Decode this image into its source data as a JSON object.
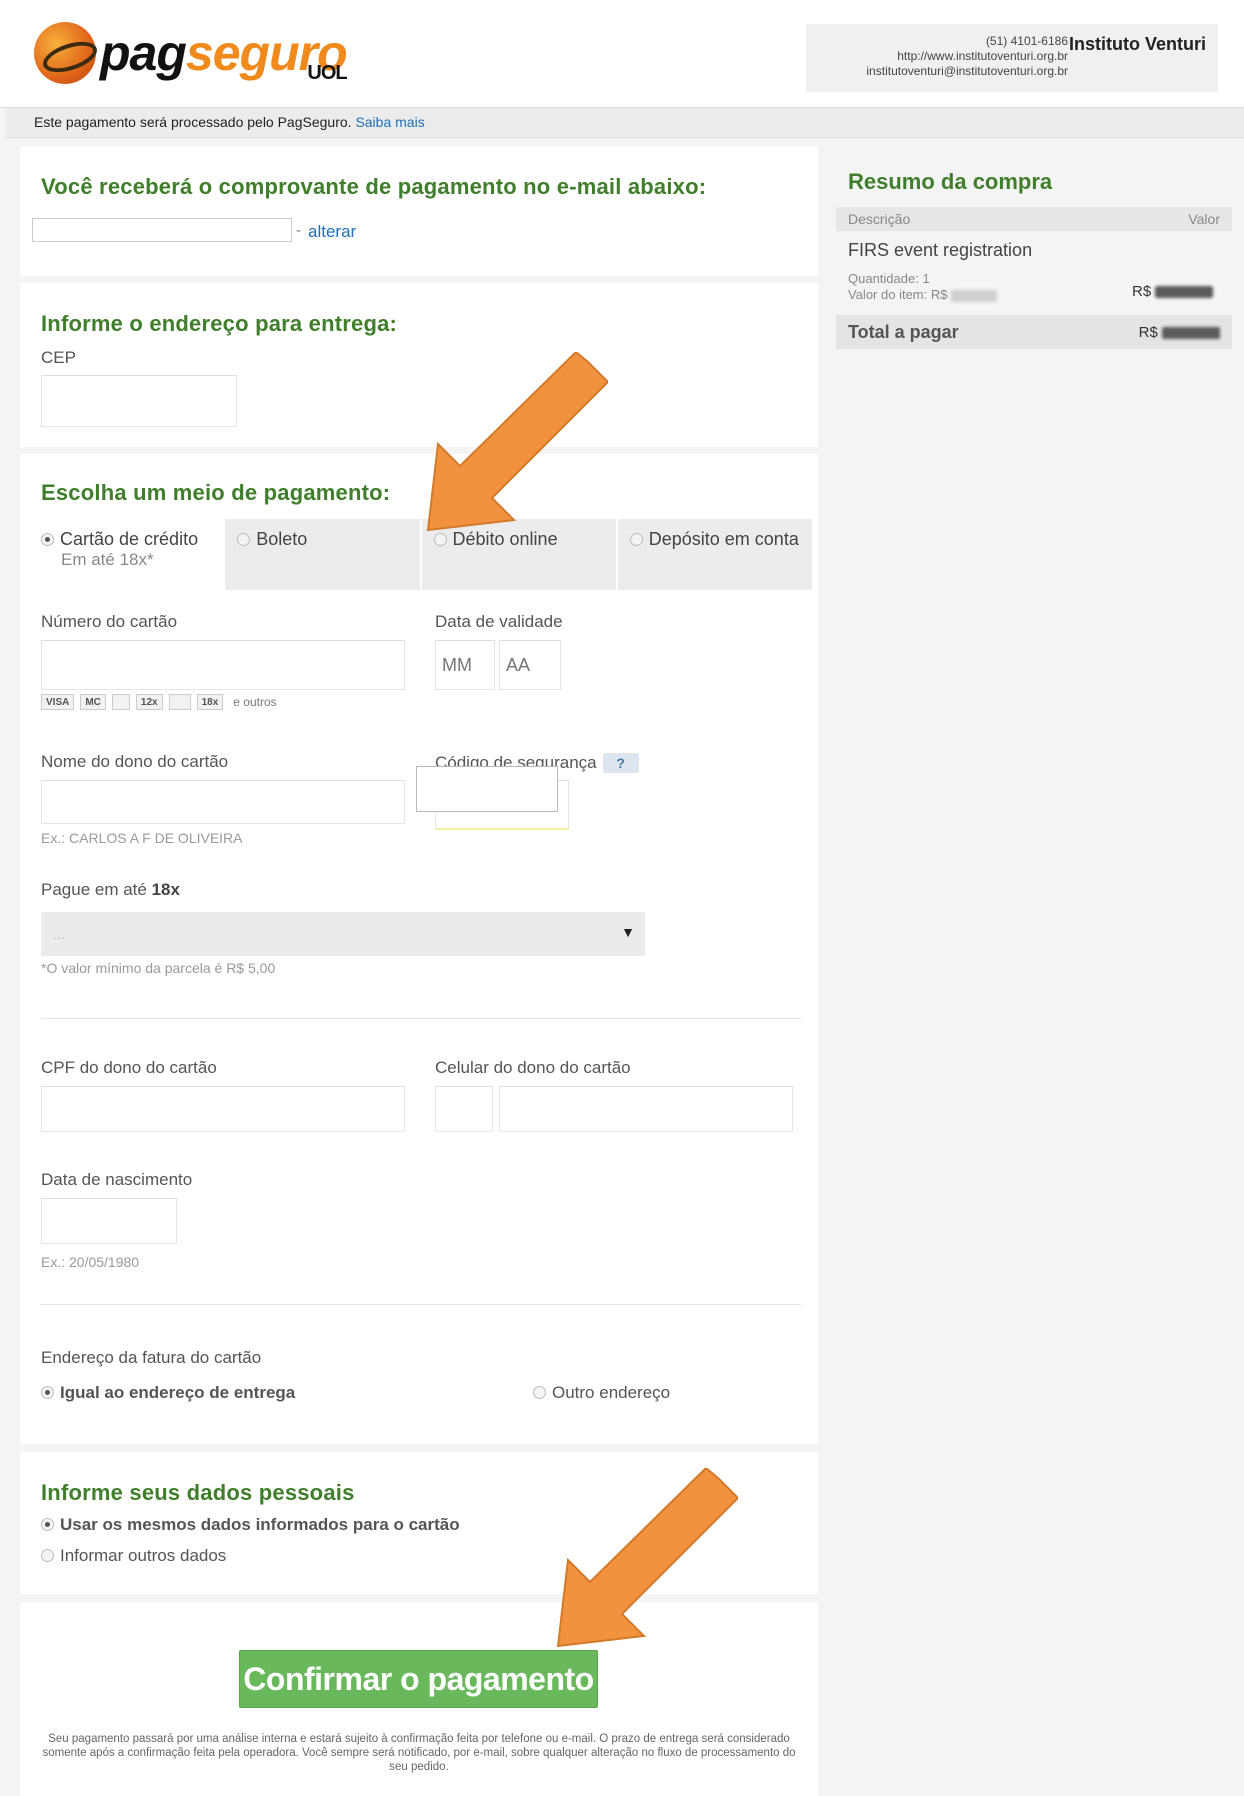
{
  "header": {
    "logo_pag": "pag",
    "logo_seguro": "seguro",
    "logo_uol": "UOL",
    "merchant_phone": "(51) 4101-6186",
    "merchant_url": "http://www.institutoventuri.org.br",
    "merchant_email": "institutoventuri@institutoventuri.org.br",
    "merchant_name": "Instituto Venturi"
  },
  "infobar": {
    "text": "Este pagamento será processado pelo PagSeguro.",
    "link": "Saiba mais"
  },
  "email_section": {
    "title": "Você receberá o comprovante de pagamento no e-mail abaixo:",
    "separator": "-",
    "change_link": "alterar"
  },
  "address_section": {
    "title": "Informe o endereço para entrega:",
    "cep_label": "CEP"
  },
  "payment_section": {
    "title": "Escolha um meio de pagamento:",
    "tabs": [
      {
        "label": "Cartão de crédito",
        "sub": "Em até 18x*"
      },
      {
        "label": "Boleto"
      },
      {
        "label": "Débito online"
      },
      {
        "label": "Depósito em conta"
      }
    ],
    "card_number_label": "Número do cartão",
    "expiry_label": "Data de validade",
    "expiry_month_placeholder": "MM",
    "expiry_year_placeholder": "AA",
    "card_logos": [
      "VISA",
      "MC",
      "",
      "12x",
      "",
      "18x"
    ],
    "card_logos_more": "e outros",
    "holder_name_label": "Nome do dono do cartão",
    "holder_name_hint": "Ex.: CARLOS A F DE OLIVEIRA",
    "security_code_label": "Código de segurança",
    "security_help": "?",
    "installments_prefix": "Pague em até",
    "installments_max": "18x",
    "installments_value": "...",
    "installments_note": "*O valor mínimo da parcela é R$ 5,00",
    "cpf_label": "CPF do dono do cartão",
    "phone_label": "Celular do dono do cartão",
    "birth_label": "Data de nascimento",
    "birth_hint": "Ex.: 20/05/1980",
    "billing_label": "Endereço da fatura do cartão",
    "billing_same": "Igual ao endereço de entrega",
    "billing_other": "Outro endereço"
  },
  "personal_section": {
    "title": "Informe seus dados pessoais",
    "same_option": "Usar os mesmos dados informados para o cartão",
    "other_option": "Informar outros dados"
  },
  "confirm": {
    "button": "Confirmar o pagamento",
    "disclaimer": "Seu pagamento passará por uma análise interna e estará sujeito à confirmação feita por telefone ou e-mail. O prazo de entrega será considerado somente após a confirmação feita pela operadora. Você sempre será notificado, por e-mail, sobre qualquer alteração no fluxo de processamento do seu pedido."
  },
  "summary": {
    "title": "Resumo da compra",
    "col_desc": "Descrição",
    "col_value": "Valor",
    "item_name": "FIRS event registration",
    "quantity": "Quantidade: 1",
    "item_value_label": "Valor do item: R$",
    "currency": "R$",
    "total_label": "Total a pagar"
  },
  "colors": {
    "section_title": "#3f7e2a",
    "confirm_button": "#6ab85c",
    "link": "#1f6fb8",
    "arrow": "#f2923f"
  }
}
